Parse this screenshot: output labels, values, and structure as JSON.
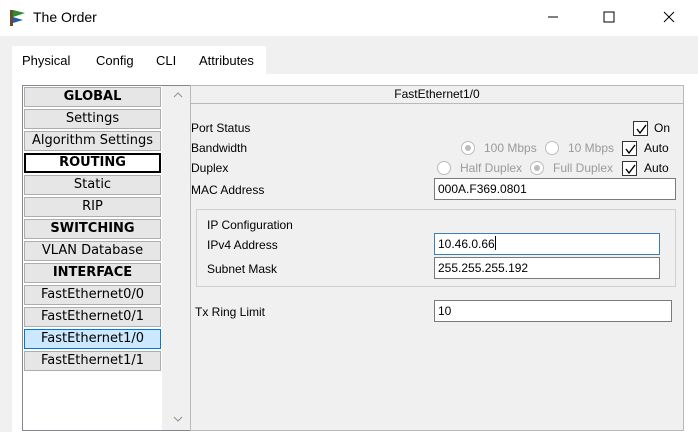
{
  "window": {
    "title": "The Order",
    "controls": {
      "minimize": "minimize-icon",
      "maximize": "maximize-icon",
      "close": "close-icon"
    }
  },
  "tabs": [
    {
      "label": "Physical",
      "active": false
    },
    {
      "label": "Config",
      "active": true
    },
    {
      "label": "CLI",
      "active": false
    },
    {
      "label": "Attributes",
      "active": false
    }
  ],
  "nav": {
    "items": [
      {
        "label": "GLOBAL",
        "kind": "header"
      },
      {
        "label": "Settings",
        "kind": "item"
      },
      {
        "label": "Algorithm Settings",
        "kind": "item"
      },
      {
        "label": "ROUTING",
        "kind": "header-boxed"
      },
      {
        "label": "Static",
        "kind": "item"
      },
      {
        "label": "RIP",
        "kind": "item"
      },
      {
        "label": "SWITCHING",
        "kind": "header"
      },
      {
        "label": "VLAN Database",
        "kind": "item"
      },
      {
        "label": "INTERFACE",
        "kind": "header"
      },
      {
        "label": "FastEthernet0/0",
        "kind": "item"
      },
      {
        "label": "FastEthernet0/1",
        "kind": "item"
      },
      {
        "label": "FastEthernet1/0",
        "kind": "item",
        "selected": true
      },
      {
        "label": "FastEthernet1/1",
        "kind": "item"
      }
    ]
  },
  "panel": {
    "title": "FastEthernet1/0",
    "port_status": {
      "label": "Port Status",
      "checkbox_label": "On",
      "checked": true
    },
    "bandwidth": {
      "label": "Bandwidth",
      "option1": "100 Mbps",
      "option2": "10 Mbps",
      "auto_label": "Auto",
      "auto_checked": true
    },
    "duplex": {
      "label": "Duplex",
      "option1": "Half Duplex",
      "option2": "Full Duplex",
      "auto_label": "Auto",
      "auto_checked": true
    },
    "mac": {
      "label": "MAC Address",
      "value": "000A.F369.0801"
    },
    "ip_config": {
      "title": "IP Configuration",
      "ipv4_label": "IPv4 Address",
      "ipv4_value": "10.46.0.66",
      "mask_label": "Subnet Mask",
      "mask_value": "255.255.255.192"
    },
    "tx_ring": {
      "label": "Tx Ring Limit",
      "value": "10"
    }
  },
  "colors": {
    "tab_underline": "#1f5c87",
    "selected_bg": "#cce8ff",
    "selected_border": "#0078d7",
    "focus_border": "#3c7fb1"
  }
}
